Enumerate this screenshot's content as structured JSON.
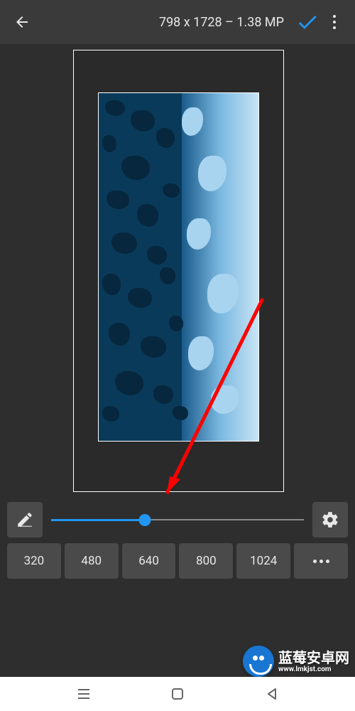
{
  "header": {
    "title": "798 x 1728 – 1.38 MP"
  },
  "slider": {
    "percent": 37
  },
  "presets": [
    "320",
    "480",
    "640",
    "800",
    "1024"
  ],
  "watermark": {
    "name": "蓝莓安卓网",
    "url": "www.lmkjst.com"
  }
}
